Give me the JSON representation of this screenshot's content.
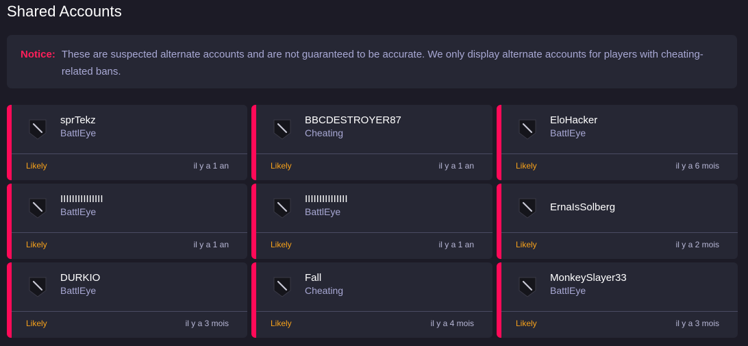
{
  "page": {
    "title": "Shared Accounts"
  },
  "notice": {
    "label": "Notice:",
    "text": "These are suspected alternate accounts and are not guaranteed to be accurate. We only display alternate accounts for players with cheating-related bans."
  },
  "colors": {
    "accent": "#ff0a58",
    "likely": "#f7a21b",
    "muted_text": "#a8a8d4",
    "card_bg": "#262734",
    "page_bg": "#1c1b26"
  },
  "accounts": [
    {
      "name": "sprTekz",
      "reason": "BattlEye",
      "confidence": "Likely",
      "time": "il y a 1 an",
      "icon": "ban-shield-icon"
    },
    {
      "name": "BBCDESTROYER87",
      "reason": "Cheating",
      "confidence": "Likely",
      "time": "il y a 1 an",
      "icon": "ban-shield-icon"
    },
    {
      "name": "EloHacker",
      "reason": "BattlEye",
      "confidence": "Likely",
      "time": "il y a 6 mois",
      "icon": "ban-shield-icon"
    },
    {
      "name": "IIIIIIIIIIIIIII",
      "reason": "BattlEye",
      "confidence": "Likely",
      "time": "il y a 1 an",
      "icon": "ban-shield-icon"
    },
    {
      "name": "IIIIIIIIIIIIIII",
      "reason": "BattlEye",
      "confidence": "Likely",
      "time": "il y a 1 an",
      "icon": "ban-shield-icon"
    },
    {
      "name": "ErnaIsSolberg",
      "reason": "",
      "confidence": "Likely",
      "time": "il y a 2 mois",
      "icon": "ban-shield-icon"
    },
    {
      "name": "DURKIO",
      "reason": "BattlEye",
      "confidence": "Likely",
      "time": "il y a 3 mois",
      "icon": "ban-shield-icon"
    },
    {
      "name": "Fall",
      "reason": "Cheating",
      "confidence": "Likely",
      "time": "il y a 4 mois",
      "icon": "ban-shield-icon"
    },
    {
      "name": "MonkeySlayer33",
      "reason": "BattlEye",
      "confidence": "Likely",
      "time": "il y a 3 mois",
      "icon": "ban-shield-icon"
    }
  ]
}
